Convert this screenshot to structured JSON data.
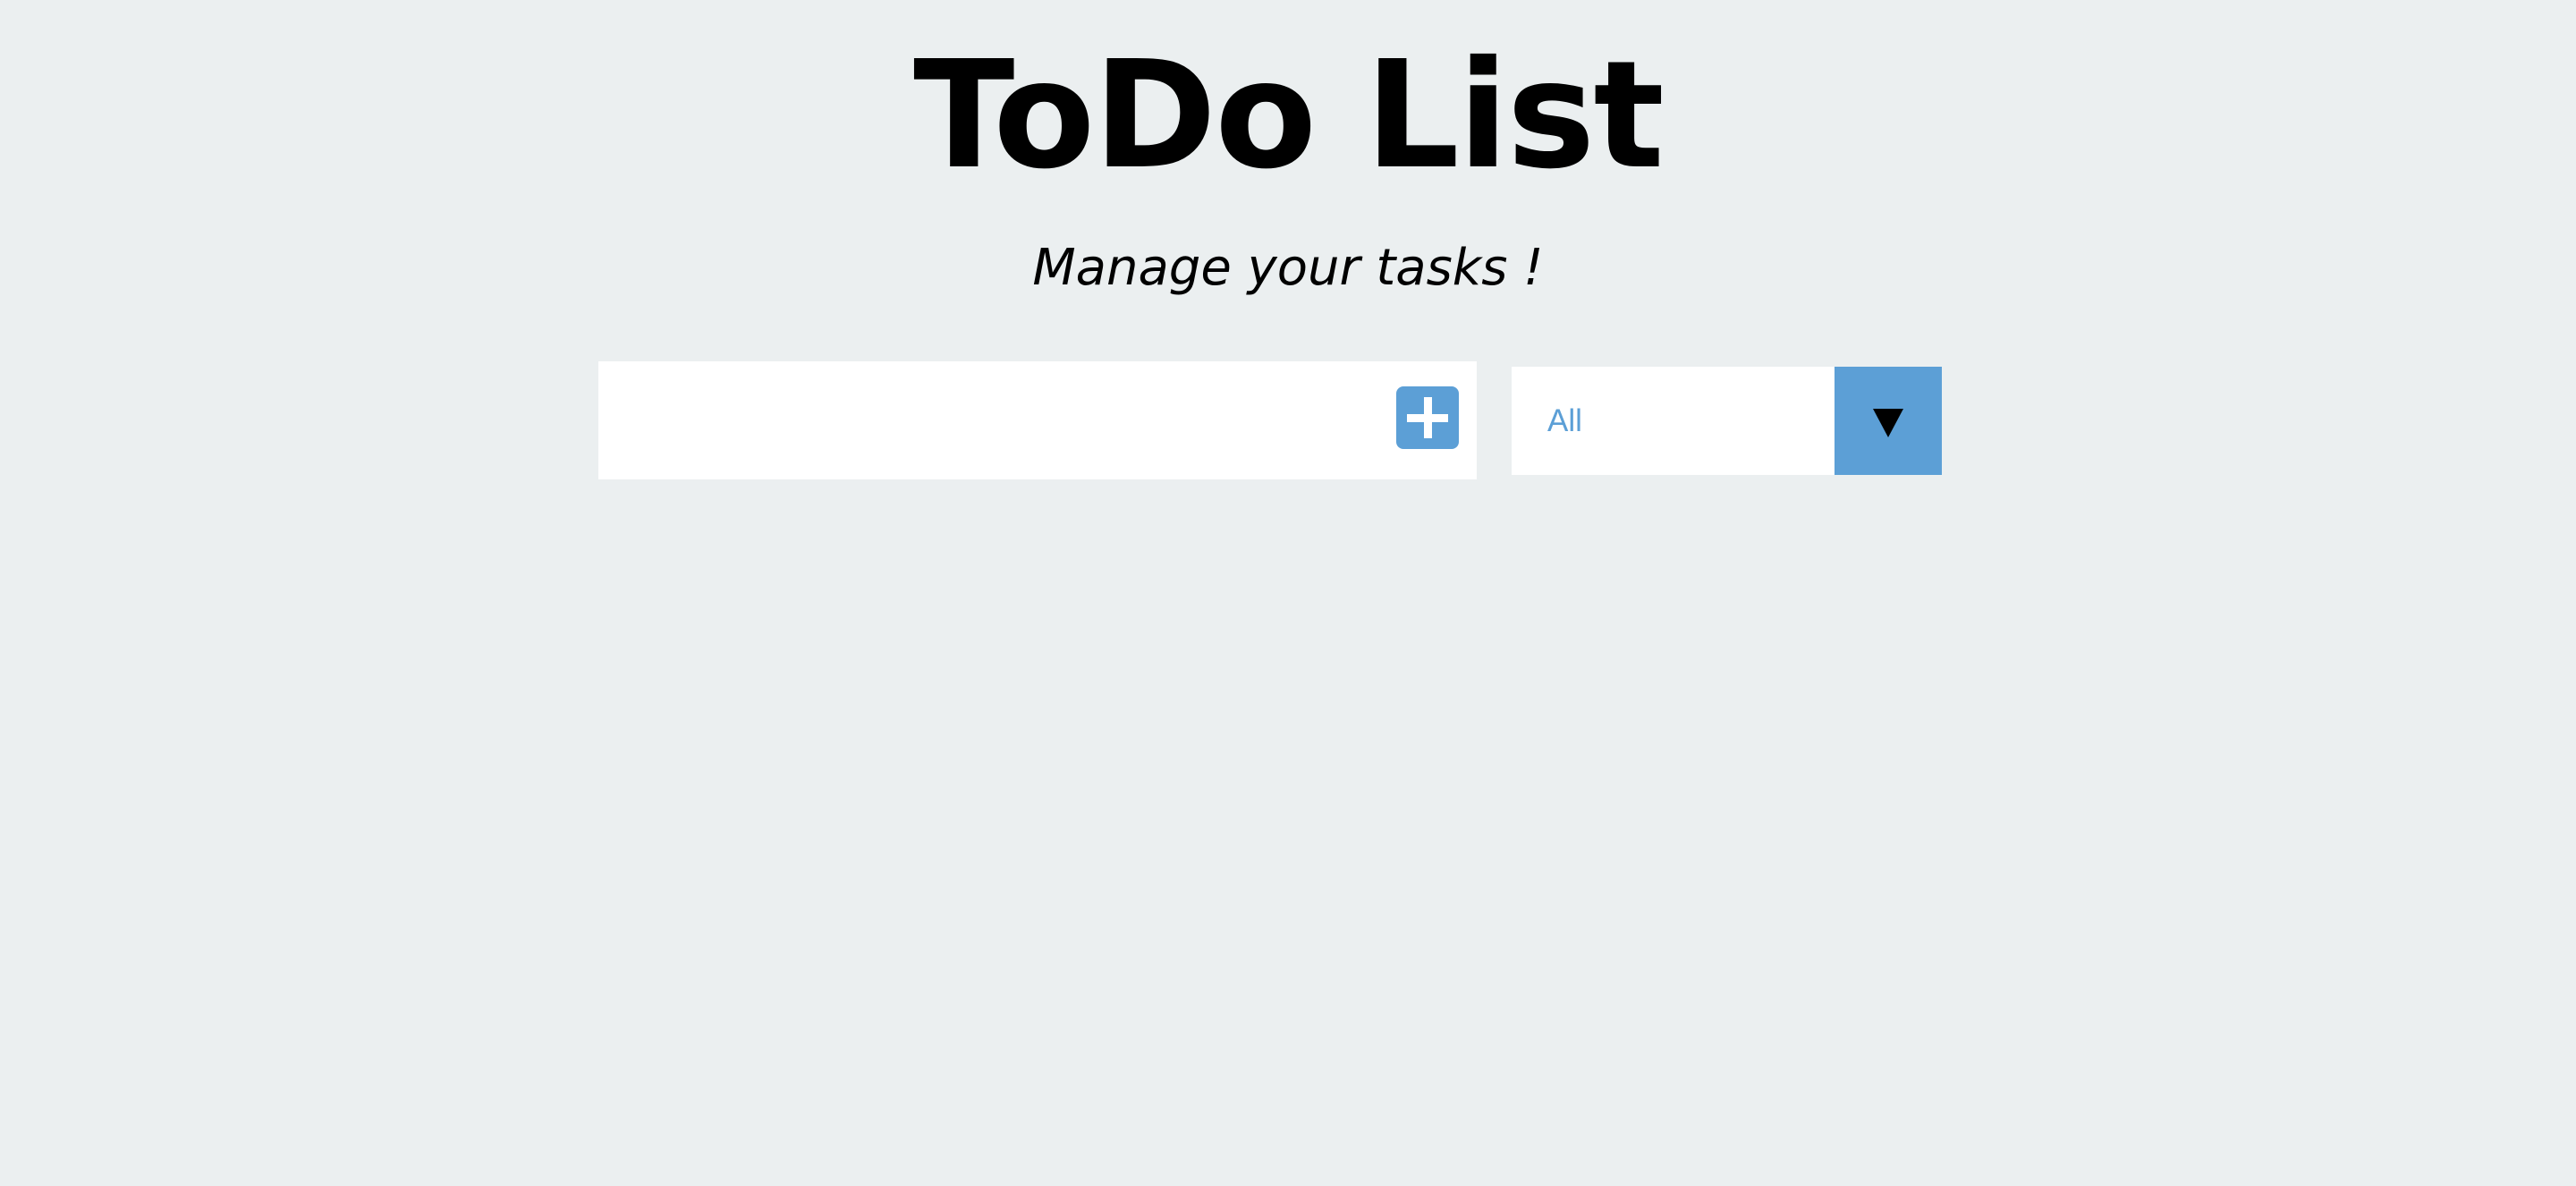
{
  "header": {
    "title": "ToDo List",
    "subtitle": "Manage your tasks !"
  },
  "todo_form": {
    "input_value": "",
    "input_placeholder": "",
    "add_button_icon": "plus-icon"
  },
  "filter": {
    "selected": "All",
    "toggle_icon": "caret-down-icon"
  },
  "colors": {
    "background": "#ebeff0",
    "accent": "#5c9fd6",
    "text": "#000000"
  }
}
